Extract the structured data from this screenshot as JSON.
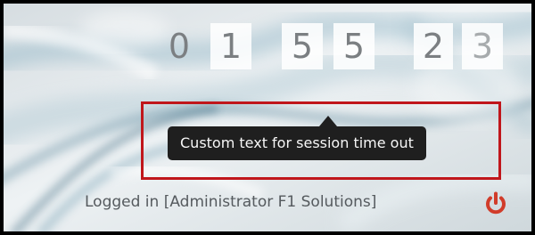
{
  "session_timer": {
    "digits": [
      "0",
      "1",
      "5",
      "5",
      "2",
      "3"
    ]
  },
  "tooltip": {
    "text": "Custom text for session time out"
  },
  "status": {
    "logged_in_text": "Logged in [Administrator F1 Solutions]"
  },
  "icons": {
    "logout": "power-icon"
  },
  "colors": {
    "highlight_border": "#c0161b",
    "tooltip_background": "#1f1f1f",
    "power_icon": "#d13c2a"
  }
}
